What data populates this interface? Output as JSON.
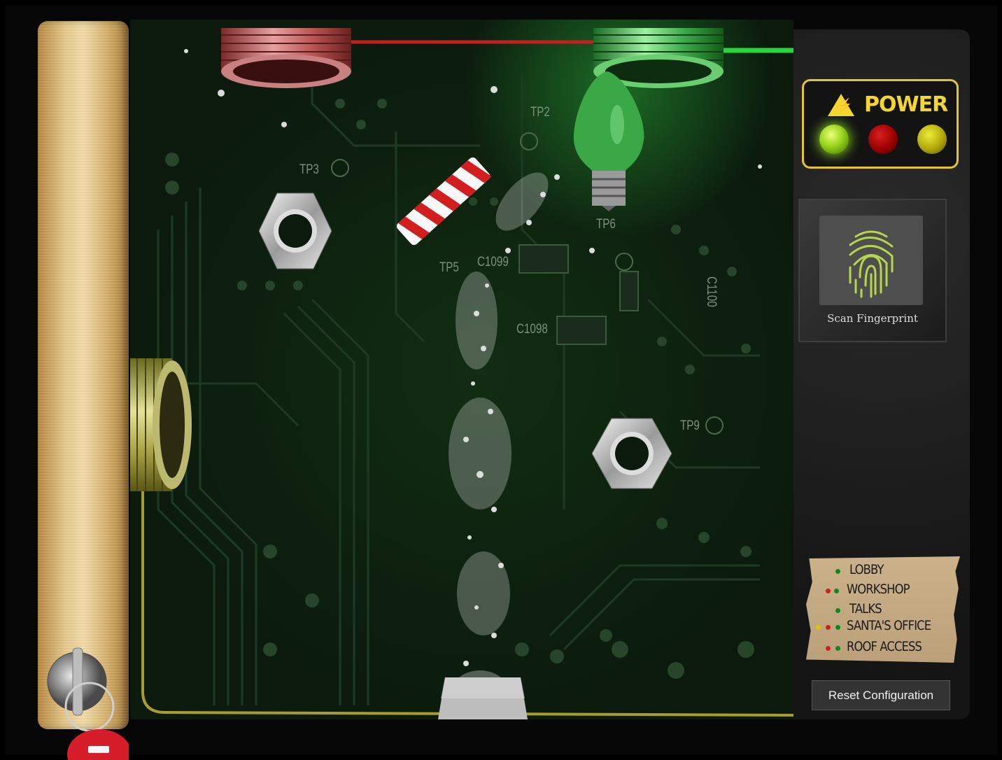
{
  "power": {
    "title": "POWER",
    "warning_icon": "high-voltage-warning-icon",
    "leds": [
      "green",
      "red",
      "yellow"
    ]
  },
  "scanner": {
    "label": "Scan Fingerprint",
    "icon": "fingerprint-icon"
  },
  "legend": {
    "items": [
      {
        "label": "LOBBY",
        "dots": [
          "g"
        ]
      },
      {
        "label": "WORKSHOP",
        "dots": [
          "r",
          "g"
        ]
      },
      {
        "label": "TALKS",
        "dots": [
          "g"
        ]
      },
      {
        "label": "SANTA'S OFFICE",
        "dots": [
          "y",
          "r",
          "g"
        ]
      },
      {
        "label": "ROOF ACCESS",
        "dots": [
          "r",
          "g"
        ]
      }
    ]
  },
  "reset_button": {
    "label": "Reset Configuration"
  },
  "board_labels": {
    "tp2": "TP2",
    "tp3": "TP3",
    "tp5": "TP5",
    "tp6": "TP6",
    "tp9": "TP9",
    "c1098": "C1098",
    "c1099": "C1099",
    "c1100": "C1100"
  },
  "colors": {
    "power_yellow": "#f4d630",
    "led_green": "#98d41b",
    "led_red": "#900000",
    "led_yellow": "#b0a70a"
  }
}
